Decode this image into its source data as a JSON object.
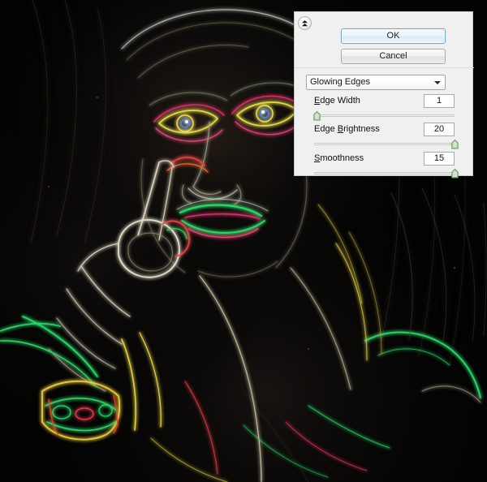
{
  "artwork": {
    "name": "glowing-edges-portrait",
    "description": "Dark portrait of a woman with hand near face, rendered with a Glowing Edges neon-outline filter",
    "background_color": "#030303",
    "edge_colors": [
      "#2ee6a0",
      "#f2e34a",
      "#e0345a",
      "#ffffff",
      "#d6a0f0",
      "#7fe0ff",
      "#ff8a3d"
    ]
  },
  "panel": {
    "name": "filter-gallery-panel",
    "collapse_icon": "double-chevron-up-icon",
    "ok_label": "OK",
    "cancel_label": "Cancel",
    "filter_select": {
      "selected": "Glowing Edges",
      "caret_icon": "chevron-down-icon",
      "options": [
        "Glowing Edges"
      ]
    },
    "controls": [
      {
        "label": "Edge Width",
        "accel_index": 0,
        "value": "1",
        "slider_percent": 2,
        "min": 1,
        "max": 14
      },
      {
        "label": "Edge Brightness",
        "accel_index": 5,
        "value": "20",
        "slider_percent": 100,
        "min": 0,
        "max": 20
      },
      {
        "label": "Smoothness",
        "accel_index": 0,
        "value": "15",
        "slider_percent": 100,
        "min": 1,
        "max": 15
      }
    ],
    "colors": {
      "panel_background": "#f0f0f0",
      "panel_border": "#c6c6c6",
      "focus_accent": "#6ea9d6",
      "slider_thumb": "#7fb07a",
      "text": "#0f0f0f"
    }
  }
}
